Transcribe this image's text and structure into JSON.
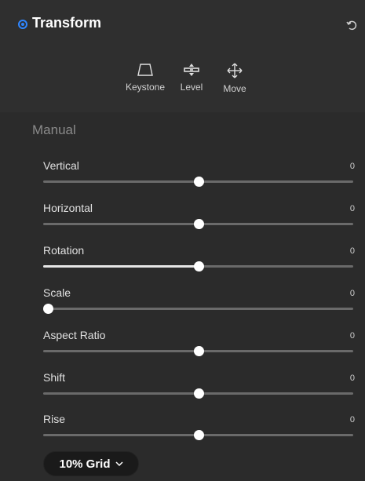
{
  "header": {
    "title": "Transform"
  },
  "tools": [
    {
      "label": "Keystone",
      "icon": "keystone-icon"
    },
    {
      "label": "Level",
      "icon": "level-icon"
    },
    {
      "label": "Move",
      "icon": "move-icon"
    }
  ],
  "manual": {
    "title": "Manual",
    "sliders": [
      {
        "label": "Vertical",
        "value": "0",
        "position": 0.5,
        "filled": false
      },
      {
        "label": "Horizontal",
        "value": "0",
        "position": 0.5,
        "filled": false
      },
      {
        "label": "Rotation",
        "value": "0",
        "position": 0.5,
        "filled": true
      },
      {
        "label": "Scale",
        "value": "0",
        "position": 0.0,
        "filled": false
      },
      {
        "label": "Aspect Ratio",
        "value": "0",
        "position": 0.5,
        "filled": false
      },
      {
        "label": "Shift",
        "value": "0",
        "position": 0.5,
        "filled": false
      },
      {
        "label": "Rise",
        "value": "0",
        "position": 0.5,
        "filled": false
      }
    ]
  },
  "grid": {
    "label": "10% Grid"
  },
  "colors": {
    "accent": "#2f86ff",
    "panel": "#2b2b2b",
    "header": "#2f2f2f"
  }
}
